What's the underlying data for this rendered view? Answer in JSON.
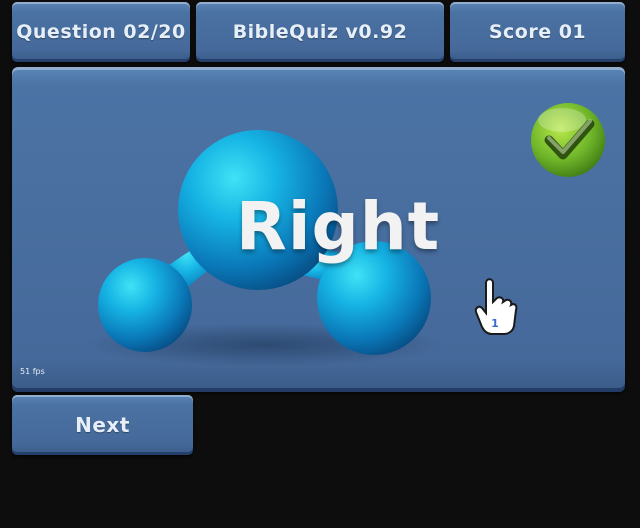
{
  "header": {
    "question": "Question 02/20",
    "title": "BibleQuiz v0.92",
    "score": "Score 01"
  },
  "result": {
    "text": "Right",
    "status_icon": "green-checkmark-icon",
    "status_color": "#6fb62a"
  },
  "fps": "51 fps",
  "cursor": {
    "icon": "hand-pointer-icon",
    "player_number": "1"
  },
  "buttons": {
    "next": "Next"
  },
  "colors": {
    "panel": "#4a72a3",
    "background": "#0d0d0d",
    "molecule": "#1fa6d8"
  }
}
